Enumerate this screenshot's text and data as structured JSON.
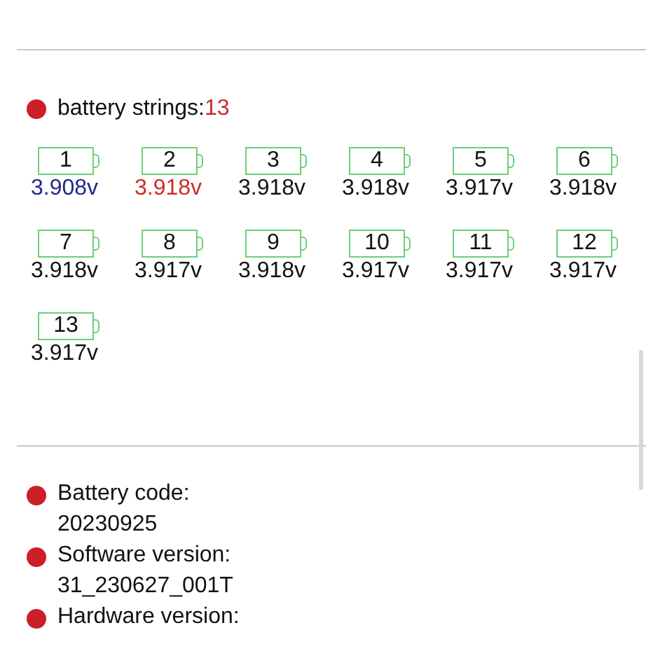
{
  "strings": {
    "label": "battery strings:",
    "count": "13"
  },
  "cells": [
    {
      "number": "1",
      "voltage": "3.908v",
      "color": "#1f2a8c"
    },
    {
      "number": "2",
      "voltage": "3.918v",
      "color": "#d02a2a"
    },
    {
      "number": "3",
      "voltage": "3.918v"
    },
    {
      "number": "4",
      "voltage": "3.918v"
    },
    {
      "number": "5",
      "voltage": "3.917v"
    },
    {
      "number": "6",
      "voltage": "3.918v"
    },
    {
      "number": "7",
      "voltage": "3.918v"
    },
    {
      "number": "8",
      "voltage": "3.917v"
    },
    {
      "number": "9",
      "voltage": "3.918v"
    },
    {
      "number": "10",
      "voltage": "3.917v"
    },
    {
      "number": "11",
      "voltage": "3.917v"
    },
    {
      "number": "12",
      "voltage": "3.917v"
    },
    {
      "number": "13",
      "voltage": "3.917v"
    }
  ],
  "info": [
    {
      "label": "Battery code:",
      "value": "20230925"
    },
    {
      "label": "Software version:",
      "value": "31_230627_001T"
    },
    {
      "label": "Hardware version:"
    }
  ]
}
